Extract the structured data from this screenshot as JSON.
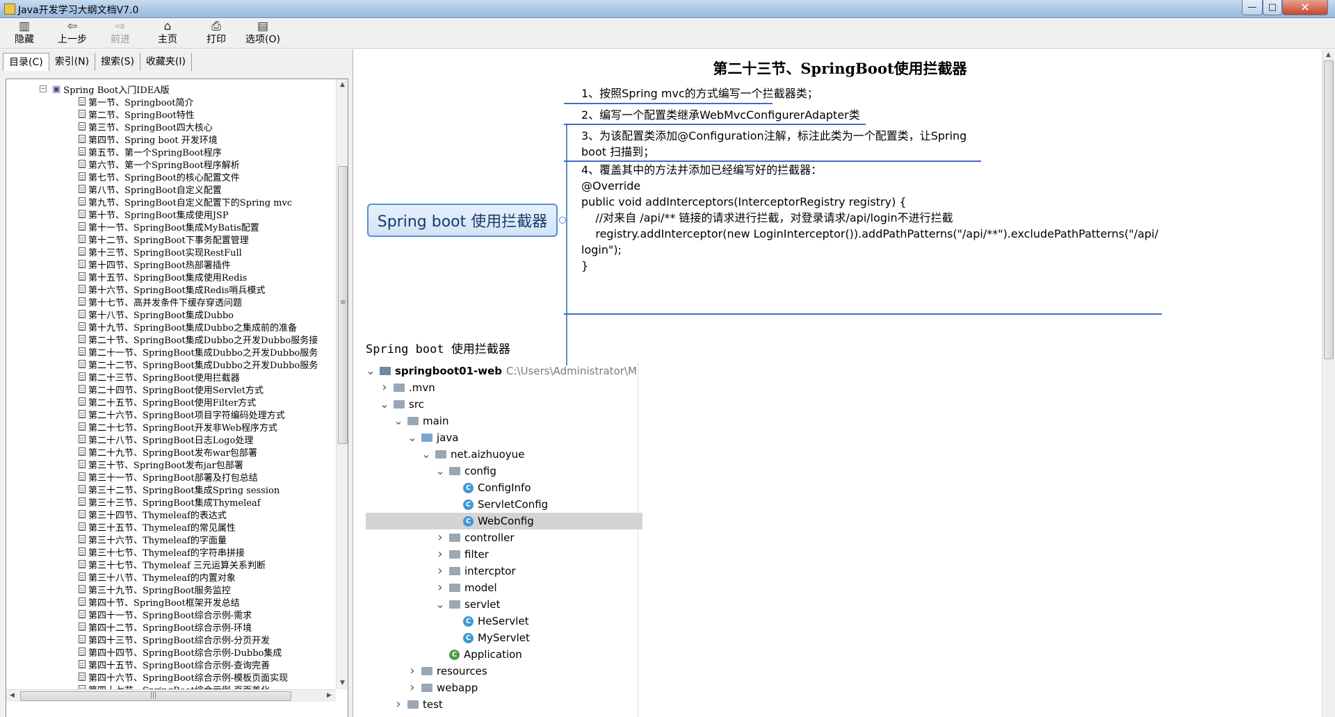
{
  "window": {
    "title": "Java开发学习大纲文档V7.0",
    "min": "—",
    "max": "□",
    "close": "✕"
  },
  "toolbar": {
    "hide": "隐藏",
    "back": "上一步",
    "forward": "前进",
    "home": "主页",
    "print": "打印",
    "options": "选项(O)",
    "icons": {
      "hide": "hide-icon",
      "back": "back-arrow-icon",
      "forward": "forward-arrow-icon",
      "home": "home-icon",
      "print": "printer-icon",
      "options": "options-icon"
    }
  },
  "nav_tabs": [
    "目录(C)",
    "索引(N)",
    "搜索(S)",
    "收藏夹(I)"
  ],
  "toc": {
    "root": "Spring Boot入门IDEA版",
    "items": [
      "第一节、Springboot简介",
      "第二节、SpringBoot特性",
      "第三节、SpringBoot四大核心",
      "第四节、Spring boot 开发环境",
      "第五节、第一个SpringBoot程序",
      "第六节、第一个SpringBoot程序解析",
      "第七节、SpringBoot的核心配置文件",
      "第八节、SpringBoot自定义配置",
      "第九节、SpringBoot自定义配置下的Spring mvc",
      "第十节、SpringBoot集成使用JSP",
      "第十一节、SpringBoot集成MyBatis配置",
      "第十二节、SpringBoot下事务配置管理",
      "第十三节、SpringBoot实现RestFull",
      "第十四节、SpringBoot热部署插件",
      "第十五节、SpringBoot集成使用Redis",
      "第十六节、SpringBoot集成Redis哨兵模式",
      "第十七节、高并发条件下缓存穿透问题",
      "第十八节、SpringBoot集成Dubbo",
      "第十九节、SpringBoot集成Dubbo之集成前的准备",
      "第二十节、SpringBoot集成Dubbo之开发Dubbo服务接",
      "第二十一节、SpringBoot集成Dubbo之开发Dubbo服务",
      "第二十二节、SpringBoot集成Dubbo之开发Dubbo服务",
      "第二十三节、SpringBoot使用拦截器",
      "第二十四节、SpringBoot使用Servlet方式",
      "第二十五节、SpringBoot使用Filter方式",
      "第二十六节、SpringBoot项目字符编码处理方式",
      "第二十七节、SpringBoot开发非Web程序方式",
      "第二十八节、SpringBoot日志Logo处理",
      "第二十九节、SpringBoot发布war包部署",
      "第三十节、SpringBoot发布jar包部署",
      "第三十一节、SpringBoot部署及打包总结",
      "第三十二节、SpringBoot集成Spring session",
      "第三十三节、SpringBoot集成Thymeleaf",
      "第三十四节、Thymeleaf的表达式",
      "第三十五节、Thymeleaf的常见属性",
      "第三十六节、Thymeleaf的字面量",
      "第三十七节、Thymeleaf的字符串拼接",
      "第三十七节、Thymeleaf 三元运算关系判断",
      "第三十八节、Thymeleaf的内置对象",
      "第三十九节、SpringBoot服务监控",
      "第四十节、SpringBoot框架开发总结",
      "第四十一节、SpringBoot综合示例-需求",
      "第四十二节、SpringBoot综合示例-环境",
      "第四十三节、SpringBoot综合示例-分页开发",
      "第四十四节、SpringBoot综合示例-Dubbo集成",
      "第四十五节、SpringBoot综合示例-查询完善",
      "第四十六节、SpringBoot综合示例-模板页面实现",
      "第四十七节、SpringBoot综合示例-页面美化"
    ],
    "hscroll_mark": "|||",
    "vscroll_mark": "≡"
  },
  "content": {
    "title": "第二十三节、SpringBoot使用拦截器",
    "mindmap": {
      "root": "Spring boot 使用拦截器",
      "nodes": [
        [
          "1、按照Spring mvc的方式编写一个拦截器类；"
        ],
        [
          "2、编写一个配置类继承WebMvcConfigurerAdapter类"
        ],
        [
          "3、为该配置类添加@Configuration注解，标注此类为一个配置类，让Spring",
          "boot 扫描到；"
        ],
        [
          "4、覆盖其中的方法并添加已经编写好的拦截器：",
          "@Override",
          "public void addInterceptors(InterceptorRegistry registry) {",
          "    //对来自 /api/** 链接的请求进行拦截，对登录请求/api/login不进行拦截",
          "    registry.addInterceptor(new LoginInterceptor()).addPathPatterns(\"/api/**\").excludePathPatterns(\"/api/",
          "login\");",
          "}"
        ]
      ]
    },
    "subtitle": "Spring boot 使用拦截器",
    "file_tree": [
      {
        "label": "springboot01-web",
        "path": "C:\\Users\\Administrator\\M",
        "type": "module",
        "level": 0,
        "arrow": "open"
      },
      {
        "label": ".mvn",
        "type": "folder",
        "level": 1,
        "arrow": "closed"
      },
      {
        "label": "src",
        "type": "folder",
        "level": 1,
        "arrow": "open"
      },
      {
        "label": "main",
        "type": "folder",
        "level": 2,
        "arrow": "open"
      },
      {
        "label": "java",
        "type": "folder-open",
        "level": 3,
        "arrow": "open"
      },
      {
        "label": "net.aizhuoyue",
        "type": "folder",
        "level": 4,
        "arrow": "open"
      },
      {
        "label": "config",
        "type": "folder",
        "level": 5,
        "arrow": "open"
      },
      {
        "label": "ConfigInfo",
        "type": "class",
        "level": 6,
        "arrow": "none"
      },
      {
        "label": "ServletConfig",
        "type": "class",
        "level": 6,
        "arrow": "none"
      },
      {
        "label": "WebConfig",
        "type": "class",
        "level": 6,
        "arrow": "none",
        "selected": true
      },
      {
        "label": "controller",
        "type": "folder",
        "level": 5,
        "arrow": "closed"
      },
      {
        "label": "filter",
        "type": "folder",
        "level": 5,
        "arrow": "closed"
      },
      {
        "label": "intercptor",
        "type": "folder",
        "level": 5,
        "arrow": "closed"
      },
      {
        "label": "model",
        "type": "folder",
        "level": 5,
        "arrow": "closed"
      },
      {
        "label": "servlet",
        "type": "folder",
        "level": 5,
        "arrow": "open"
      },
      {
        "label": "HeServlet",
        "type": "class",
        "level": 6,
        "arrow": "none"
      },
      {
        "label": "MyServlet",
        "type": "class",
        "level": 6,
        "arrow": "none"
      },
      {
        "label": "Application",
        "type": "app",
        "level": 5,
        "arrow": "none"
      },
      {
        "label": "resources",
        "type": "folder",
        "level": 3,
        "arrow": "closed"
      },
      {
        "label": "webapp",
        "type": "folder",
        "level": 3,
        "arrow": "closed"
      },
      {
        "label": "test",
        "type": "folder",
        "level": 2,
        "arrow": "closed"
      }
    ],
    "class_glyph": "C"
  },
  "colors": {
    "mindmap_accent": "#3b6fc0",
    "titlebar": "#a9c6e4",
    "selected_row": "#d4d4d4"
  }
}
